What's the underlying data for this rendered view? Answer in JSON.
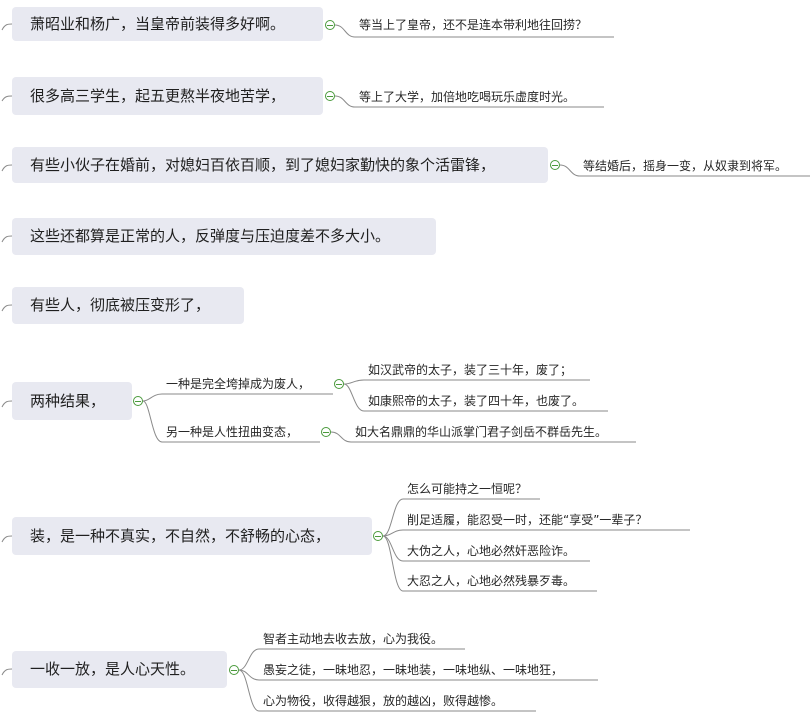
{
  "topics": [
    {
      "text": "萧昭业和杨广，当皇帝前装得多好啊。",
      "children": [
        {
          "text": "等当上了皇帝，还不是连本带利地往回捞？"
        }
      ]
    },
    {
      "text": "很多高三学生，起五更熬半夜地苦学，",
      "children": [
        {
          "text": "等上了大学，加倍地吃喝玩乐虚度时光。"
        }
      ]
    },
    {
      "text": "有些小伙子在婚前，对媳妇百依百顺，到了媳妇家勤快的象个活雷锋，",
      "children": [
        {
          "text": "等结婚后，摇身一变，从奴隶到将军。"
        }
      ]
    },
    {
      "text": "这些还都算是正常的人，反弹度与压迫度差不多大小。",
      "children": []
    },
    {
      "text": "有些人，彻底被压变形了，",
      "children": []
    },
    {
      "text": "两种结果，",
      "children": [
        {
          "text": "一种是完全垮掉成为废人，",
          "children": [
            {
              "text": "如汉武帝的太子，装了三十年，废了；"
            },
            {
              "text": "如康熙帝的太子，装了四十年，也废了。"
            }
          ]
        },
        {
          "text": "另一种是人性扭曲变态，",
          "children": [
            {
              "text": "如大名鼎鼎的华山派掌门君子剑岳不群岳先生。"
            }
          ]
        }
      ]
    },
    {
      "text": "装，是一种不真实，不自然，不舒畅的心态，",
      "children": [
        {
          "text": "怎么可能持之一恒呢？"
        },
        {
          "text": "削足适履，能忍受一时，还能“享受”一辈子？"
        },
        {
          "text": "大伪之人，心地必然奸恶险诈。"
        },
        {
          "text": "大忍之人，心地必然残暴歹毒。"
        }
      ]
    },
    {
      "text": "一收一放，是人心天性。",
      "children": [
        {
          "text": "智者主动地去收去放，心为我役。"
        },
        {
          "text": "愚妄之徒，一昧地忍，一昧地装，一味地纵、一味地狂，"
        },
        {
          "text": "心为物役，收得越狠，放的越凶，败得越惨。"
        }
      ]
    }
  ],
  "colors": {
    "node_fill": "#e8e9f1",
    "line": "#8a8a8a",
    "collapse_icon": "#4a9a3c"
  }
}
